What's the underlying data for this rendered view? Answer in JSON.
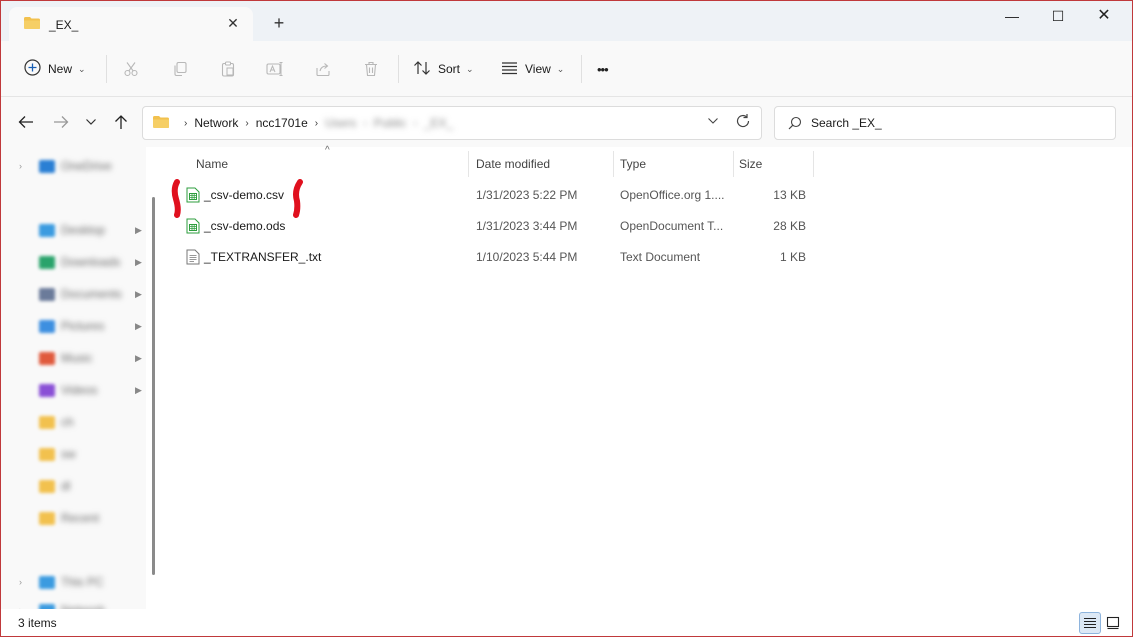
{
  "window": {
    "tab_title": "_EX_",
    "new_tab_symbol": "+",
    "minimize_symbol": "—",
    "maximize_symbol": "☐",
    "close_symbol": "✕"
  },
  "toolbar": {
    "new_label": "New",
    "sort_label": "Sort",
    "view_label": "View",
    "more_label": "•••",
    "icons": [
      "cut-icon",
      "copy-icon",
      "paste-icon",
      "rename-icon",
      "share-icon",
      "delete-icon"
    ]
  },
  "address": {
    "crumbs": [
      "Network",
      "ncc1701e"
    ],
    "blurred_crumbs": [
      "Users",
      "Public",
      "_EX_"
    ],
    "search_placeholder": "Search _EX_"
  },
  "sidebar": {
    "items": [
      {
        "label": "OneDrive",
        "color": "#2a7fd4"
      },
      {
        "label": "Desktop",
        "color": "#3b9be0"
      },
      {
        "label": "Downloads",
        "color": "#2aa36b"
      },
      {
        "label": "Documents",
        "color": "#6b7b9a"
      },
      {
        "label": "Pictures",
        "color": "#3d8fe0"
      },
      {
        "label": "Music",
        "color": "#e05a3d"
      },
      {
        "label": "Videos",
        "color": "#8a4fd6"
      },
      {
        "label": "ch",
        "color": "#f2c14e"
      },
      {
        "label": "sw",
        "color": "#f2c14e"
      },
      {
        "label": "dl",
        "color": "#f2c14e"
      },
      {
        "label": "Recent",
        "color": "#f2c14e"
      },
      {
        "label": "This PC",
        "color": "#3b9be0"
      },
      {
        "label": "Network",
        "color": "#3b9be0"
      }
    ]
  },
  "columns": {
    "name": "Name",
    "date": "Date modified",
    "type": "Type",
    "size": "Size"
  },
  "files": [
    {
      "name": "_csv-demo.csv",
      "date": "1/31/2023 5:22 PM",
      "type": "OpenOffice.org 1....",
      "size": "13 KB",
      "icon": "spreadsheet-icon"
    },
    {
      "name": "_csv-demo.ods",
      "date": "1/31/2023 3:44 PM",
      "type": "OpenDocument T...",
      "size": "28 KB",
      "icon": "spreadsheet-icon"
    },
    {
      "name": "_TEXTRANSFER_.txt",
      "date": "1/10/2023 5:44 PM",
      "type": "Text Document",
      "size": "1 KB",
      "icon": "text-file-icon"
    }
  ],
  "status": {
    "item_count": "3 items"
  },
  "colors": {
    "frame": "#c0393b",
    "annotation": "#e0101e",
    "folder": "#f2c14e",
    "spreadsheet": "#2e9e3e"
  }
}
